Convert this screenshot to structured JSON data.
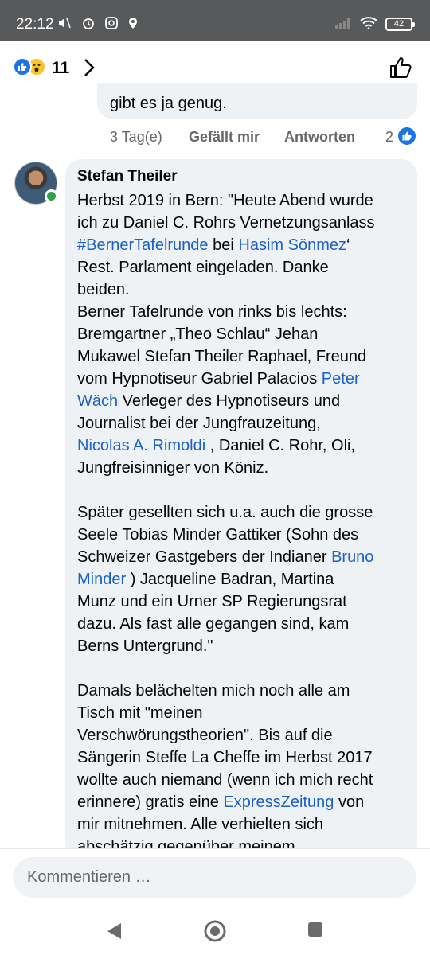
{
  "status_bar": {
    "time": "22:12",
    "battery": "42",
    "left_icons": [
      "mute-icon",
      "alarm-icon",
      "instagram-icon",
      "location-icon"
    ],
    "right_icons": [
      "signal-icon",
      "wifi-icon",
      "battery-icon"
    ]
  },
  "reactions": {
    "count": "11",
    "types": [
      "like",
      "wow"
    ]
  },
  "previous_comment": {
    "text_tail": "gibt es ja genug.",
    "time": "3 Tag(e)",
    "like_label": "Gefällt mir",
    "reply_label": "Antworten",
    "reaction_count": "2"
  },
  "comment": {
    "author": "Stefan Theiler",
    "lines": [
      [
        {
          "t": "Herbst 2019 in Bern: \"Heute Abend wurde"
        }
      ],
      [
        {
          "t": "ich zu Daniel C. Rohrs Vernetzungsanlass"
        }
      ],
      [
        {
          "t": "#BernerTafelrunde",
          "link": true
        },
        {
          "t": " bei "
        },
        {
          "t": "Hasim Sönmez",
          "link": true
        },
        {
          "t": "‘"
        }
      ],
      [
        {
          "t": "Rest. Parlament eingeladen. Danke"
        }
      ],
      [
        {
          "t": "beiden."
        }
      ],
      [
        {
          "t": "Berner Tafelrunde von rinks bis lechts:"
        }
      ],
      [
        {
          "t": "Bremgartner „Theo Schlau“  Jehan"
        }
      ],
      [
        {
          "t": "Mukawel Stefan Theiler Raphael, Freund"
        }
      ],
      [
        {
          "t": "vom Hypnotiseur Gabriel Palacios "
        },
        {
          "t": "Peter",
          "link": true
        }
      ],
      [
        {
          "t": "Wäch",
          "link": true
        },
        {
          "t": " Verleger des Hypnotiseurs und"
        }
      ],
      [
        {
          "t": "Journalist bei der Jungfrauzeitung,"
        }
      ],
      [
        {
          "t": "Nicolas A. Rimoldi",
          "link": true
        },
        {
          "t": " , Daniel C. Rohr, Oli,"
        }
      ],
      [
        {
          "t": "Jungfreisinniger von Köniz."
        }
      ],
      [],
      [
        {
          "t": "Später gesellten sich u.a. auch die grosse"
        }
      ],
      [
        {
          "t": "Seele Tobias Minder Gattiker (Sohn des"
        }
      ],
      [
        {
          "t": "Schweizer Gastgebers der Indianer "
        },
        {
          "t": "Bruno",
          "link": true
        }
      ],
      [
        {
          "t": "Minder",
          "link": true
        },
        {
          "t": " ) Jacqueline Badran, Martina"
        }
      ],
      [
        {
          "t": "Munz und ein Urner SP Regierungsrat"
        }
      ],
      [
        {
          "t": "dazu. Als fast alle gegangen sind, kam"
        }
      ],
      [
        {
          "t": "Berns Untergrund.\""
        }
      ],
      [],
      [
        {
          "t": "Damals belächelten mich noch alle am"
        }
      ],
      [
        {
          "t": "Tisch mit \"meinen"
        }
      ],
      [
        {
          "t": "Verschwörungstheorien\". Bis auf die"
        }
      ],
      [
        {
          "t": "Sängerin Steffe La Cheffe im Herbst 2017"
        }
      ],
      [
        {
          "t": "wollte auch niemand (wenn ich mich recht"
        }
      ],
      [
        {
          "t": "erinnere) gratis eine "
        },
        {
          "t": "ExpressZeitung",
          "link": true
        },
        {
          "t": " von"
        }
      ],
      [
        {
          "t": "mir mitnehmen. Alle verhielten sich"
        }
      ],
      [
        {
          "t": "abschätzig gegenüber meinem"
        }
      ]
    ]
  },
  "composer": {
    "placeholder": "Kommentieren …"
  },
  "nav": {
    "icons": [
      "back-icon",
      "home-icon",
      "recent-apps-icon"
    ]
  },
  "colors": {
    "accent": "#1b74e4",
    "link": "#1b61c9",
    "bubble": "#eff2f5",
    "status_bar": "#58595b"
  }
}
